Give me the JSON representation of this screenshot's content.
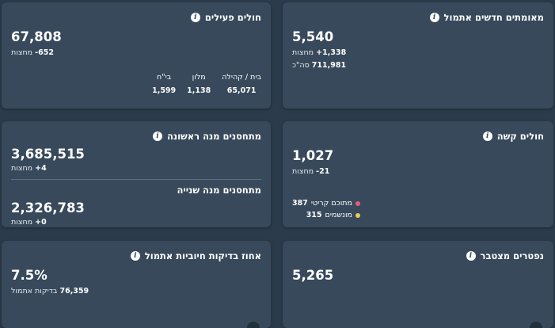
{
  "cards": {
    "new_confirmed": {
      "title": "מאומתים חדשים אתמול",
      "value": "5,540",
      "change_num": "+1,338",
      "change_label": "מחצות",
      "total_num": "711,981",
      "total_label": "סה\"כ"
    },
    "active": {
      "title": "חולים פעילים",
      "value": "67,808",
      "change_num": "-652",
      "change_label": "מחצות",
      "cols": [
        {
          "label": "בית / קהילה",
          "value": "65,071"
        },
        {
          "label": "מלון",
          "value": "1,138"
        },
        {
          "label": "בי\"ח",
          "value": "1,599"
        }
      ]
    },
    "serious": {
      "title": "חולים קשה",
      "value": "1,027",
      "change_num": "-21",
      "change_label": "מחצות",
      "legend": [
        {
          "label": "מתוכם קריטי",
          "value": "387",
          "color": "#e85b7a"
        },
        {
          "label": "מונשמים",
          "value": "315",
          "color": "#e7c85a"
        }
      ]
    },
    "vaccinated": {
      "first_title": "מתחסנים מנה ראשונה",
      "first_value": "3,685,515",
      "first_change_num": "+4",
      "first_change_label": "מחצות",
      "second_title": "מתחסנים מנה שנייה",
      "second_value": "2,326,783",
      "second_change_num": "+0",
      "second_change_label": "מחצות"
    },
    "deaths": {
      "title": "נפטרים מצטבר",
      "value": "5,265"
    },
    "positive_rate": {
      "title": "אחוז בדיקות חיוביות אתמול",
      "value": "7.5%",
      "tests_num": "76,359",
      "tests_label": "בדיקות אתמול"
    }
  },
  "icons": {
    "info": "i"
  }
}
